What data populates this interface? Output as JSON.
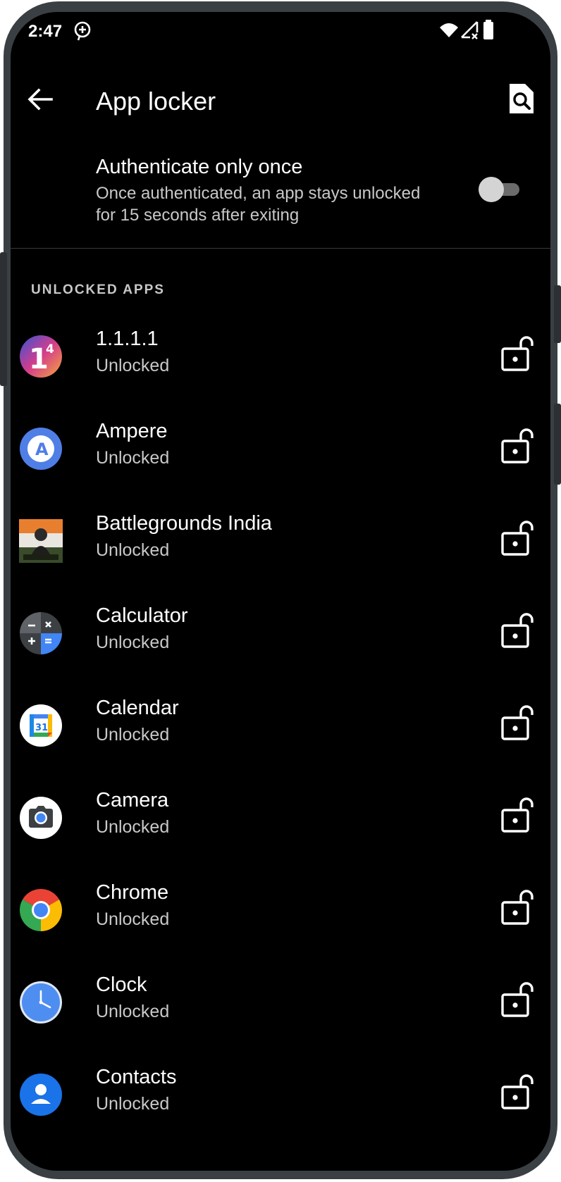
{
  "status_bar": {
    "time": "2:47",
    "icons": [
      "data-saver-icon",
      "wifi-icon",
      "signal-no-data-icon",
      "battery-icon"
    ]
  },
  "app_bar": {
    "title": "App locker",
    "back_icon": "arrow-back-icon",
    "search_icon": "search-apps-icon"
  },
  "setting": {
    "title": "Authenticate only once",
    "subtitle": "Once authenticated, an app stays unlocked for 15 seconds after exiting",
    "toggle_on": false
  },
  "section_header": "UNLOCKED APPS",
  "apps": [
    {
      "name": "1.1.1.1",
      "status": "Unlocked",
      "icon": "cloudflare-1111-icon"
    },
    {
      "name": "Ampere",
      "status": "Unlocked",
      "icon": "ampere-icon"
    },
    {
      "name": "Battlegrounds India",
      "status": "Unlocked",
      "icon": "battlegrounds-india-icon"
    },
    {
      "name": "Calculator",
      "status": "Unlocked",
      "icon": "calculator-icon"
    },
    {
      "name": "Calendar",
      "status": "Unlocked",
      "icon": "calendar-icon",
      "icon_text": "31"
    },
    {
      "name": "Camera",
      "status": "Unlocked",
      "icon": "camera-icon"
    },
    {
      "name": "Chrome",
      "status": "Unlocked",
      "icon": "chrome-icon"
    },
    {
      "name": "Clock",
      "status": "Unlocked",
      "icon": "clock-icon"
    },
    {
      "name": "Contacts",
      "status": "Unlocked",
      "icon": "contacts-icon"
    }
  ],
  "colors": {
    "background": "#000000",
    "text_primary": "#ffffff",
    "text_secondary": "#c8c8c8",
    "frame": "#3a3f44"
  }
}
